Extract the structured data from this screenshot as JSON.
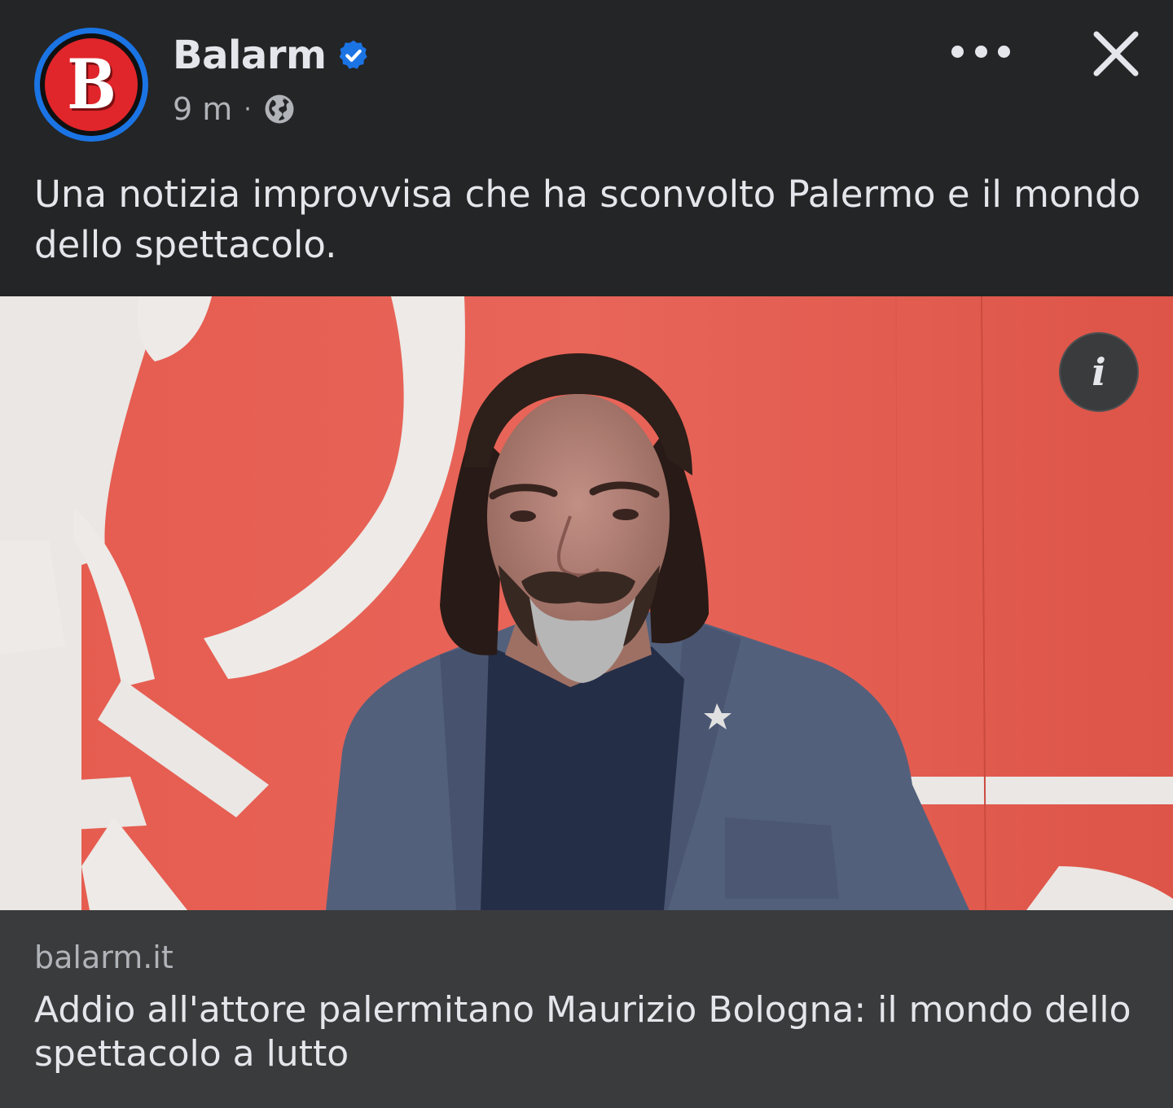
{
  "post": {
    "page_name": "Balarm",
    "avatar_letter": "B",
    "timestamp": "9 m",
    "separator": "·",
    "audience_icon": "globe-icon",
    "verified_icon": "verified-badge-icon",
    "more_icon": "more-options-icon",
    "close_icon": "close-icon",
    "message": "Una notizia improvvisa che ha sconvolto Palermo e il mondo dello spettacolo.",
    "info_glyph": "i"
  },
  "link_preview": {
    "domain": "balarm.it",
    "title": "Addio all'attore palermitano Maurizio Bologna: il mondo dello spettacolo a lutto"
  },
  "colors": {
    "background": "#242526",
    "link_background": "#3a3b3c",
    "text_primary": "#e4e6eb",
    "text_secondary": "#b0b3b8",
    "verified_blue": "#1b74e4",
    "brand_red": "#e0262b",
    "photo_backdrop": "#e8574a"
  }
}
